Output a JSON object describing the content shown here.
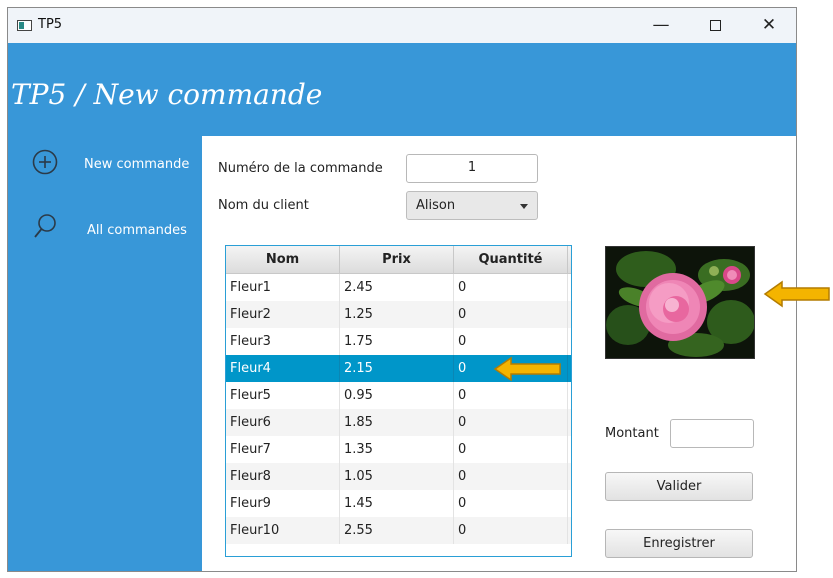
{
  "window": {
    "title": "TP5",
    "controls": {
      "minimize": "—",
      "close": "✕"
    }
  },
  "header": {
    "title": "TP5 / New commande"
  },
  "sidebar": {
    "items": [
      {
        "label": "New commande",
        "icon": "plus-circle-icon"
      },
      {
        "label": "All commandes",
        "icon": "search-icon"
      }
    ]
  },
  "form": {
    "order_number_label": "Numéro de la commande",
    "order_number_value": "1",
    "client_label": "Nom du client",
    "client_value": "Alison"
  },
  "table": {
    "columns": [
      "Nom",
      "Prix",
      "Quantité"
    ],
    "rows": [
      [
        "Fleur1",
        "2.45",
        "0"
      ],
      [
        "Fleur2",
        "1.25",
        "0"
      ],
      [
        "Fleur3",
        "1.75",
        "0"
      ],
      [
        "Fleur4",
        "2.15",
        "0"
      ],
      [
        "Fleur5",
        "0.95",
        "0"
      ],
      [
        "Fleur6",
        "1.85",
        "0"
      ],
      [
        "Fleur7",
        "1.35",
        "0"
      ],
      [
        "Fleur8",
        "1.05",
        "0"
      ],
      [
        "Fleur9",
        "1.45",
        "0"
      ],
      [
        "Fleur10",
        "2.55",
        "0"
      ]
    ],
    "selected_row": "Fleur4"
  },
  "summary": {
    "amount_label": "Montant",
    "amount_value": "",
    "validate_label": "Valider",
    "save_label": "Enregistrer"
  },
  "colors": {
    "accent": "#3897d8",
    "selection": "#0096c9",
    "annotation_arrow": "#f4b400"
  }
}
